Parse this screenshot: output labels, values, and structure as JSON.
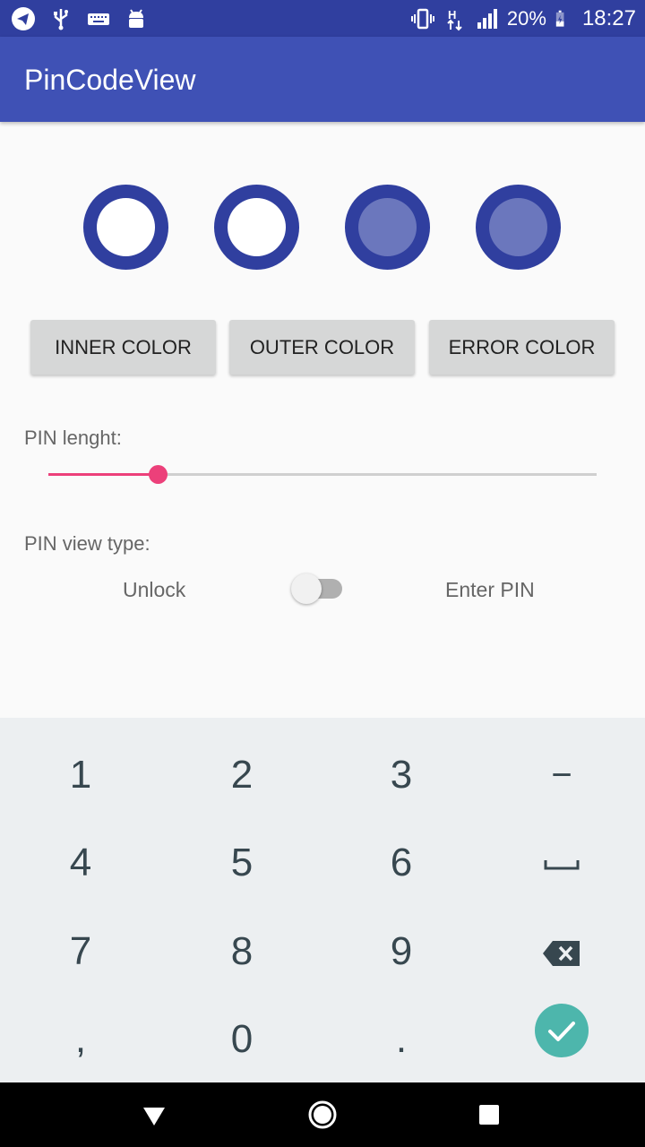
{
  "status_bar": {
    "battery_text": "20%",
    "time": "18:27",
    "background": "#303f9f",
    "icons_left": [
      "telegram-icon",
      "usb-icon",
      "keyboard-icon",
      "android-debug-icon"
    ],
    "icons_right": [
      "vibrate-icon",
      "signal-h-icon",
      "cell-signal-icon",
      "battery-icon"
    ]
  },
  "app_bar": {
    "title": "PinCodeView",
    "color": "#3f51b5"
  },
  "pin_view": {
    "dots": [
      {
        "state": "empty"
      },
      {
        "state": "empty"
      },
      {
        "state": "filled"
      },
      {
        "state": "filled"
      }
    ],
    "outer_color": "#303f9f",
    "inner_filled_color": "#6b77bd",
    "inner_empty_color": "#ffffff"
  },
  "buttons": {
    "inner_color": "INNER COLOR",
    "outer_color": "OUTER COLOR",
    "error_color": "ERROR COLOR"
  },
  "pin_length": {
    "label": "PIN lenght:",
    "slider_fraction": 0.2,
    "accent": "#ec407a"
  },
  "view_type": {
    "label": "PIN view type:",
    "left_option": "Unlock",
    "right_option": "Enter PIN",
    "switch_on": false
  },
  "keyboard": {
    "rows": [
      [
        "1",
        "2",
        "3",
        "−"
      ],
      [
        "4",
        "5",
        "6",
        "␣"
      ],
      [
        "7",
        "8",
        "9",
        "⌫"
      ],
      [
        ",",
        "0",
        ".",
        "✓"
      ]
    ],
    "done_color": "#4db6ac"
  },
  "nav_bar": {
    "icons": [
      "back-icon",
      "home-icon",
      "recents-icon"
    ]
  }
}
